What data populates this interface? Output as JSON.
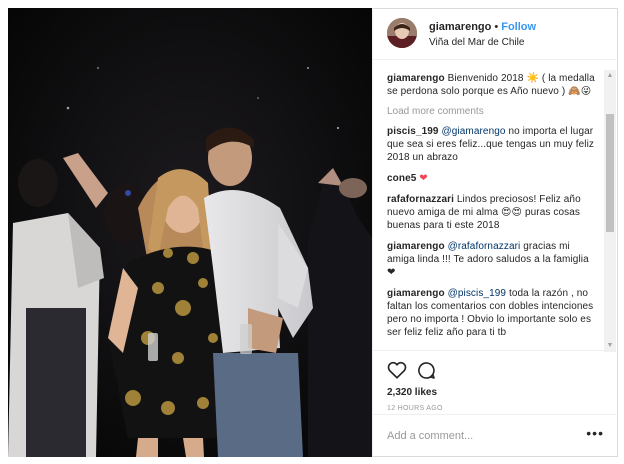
{
  "post": {
    "username": "giamarengo",
    "separator": "•",
    "follow_label": "Follow",
    "location": "Viña del Mar de Chile",
    "avatar_icon": "profile-avatar"
  },
  "comments": {
    "caption": {
      "user": "giamarengo",
      "text": "Bienvenido 2018 ☀️ ( la medalla se perdona solo porque es Año nuevo ) 🙈😜"
    },
    "load_more": "Load more comments",
    "items": [
      {
        "user": "piscis_199",
        "mention": "@giamarengo",
        "text": "no importa el lugar que sea si eres feliz...que tengas un muy feliz 2018 un abrazo"
      },
      {
        "user": "cone5",
        "mention": "",
        "text": "❤"
      },
      {
        "user": "rafafornazzari",
        "mention": "",
        "text": "Lindos preciosos! Feliz año nuevo amiga de mi alma 😍😍 puras cosas buenas para ti este 2018"
      },
      {
        "user": "giamarengo",
        "mention": "@rafafornazzari",
        "text": "gracias mi amiga linda !!! Te adoro saludos a la famiglia ❤"
      },
      {
        "user": "giamarengo",
        "mention": "@piscis_199",
        "text": "toda la razón , no faltan los comentarios con dobles intenciones pero no importa ! Obvio lo importante solo es ser feliz feliz año para ti tb"
      }
    ]
  },
  "actions": {
    "like_icon": "heart-outline-icon",
    "comment_icon": "comment-bubble-icon",
    "likes": "2,320 likes",
    "time_ago": "12 HOURS AGO"
  },
  "add_comment": {
    "placeholder": "Add a comment...",
    "more_label": "•••"
  },
  "colors": {
    "follow": "#3897f0",
    "text": "#262626",
    "muted": "#999999",
    "mention": "#003569",
    "heart": "#ed4956"
  }
}
